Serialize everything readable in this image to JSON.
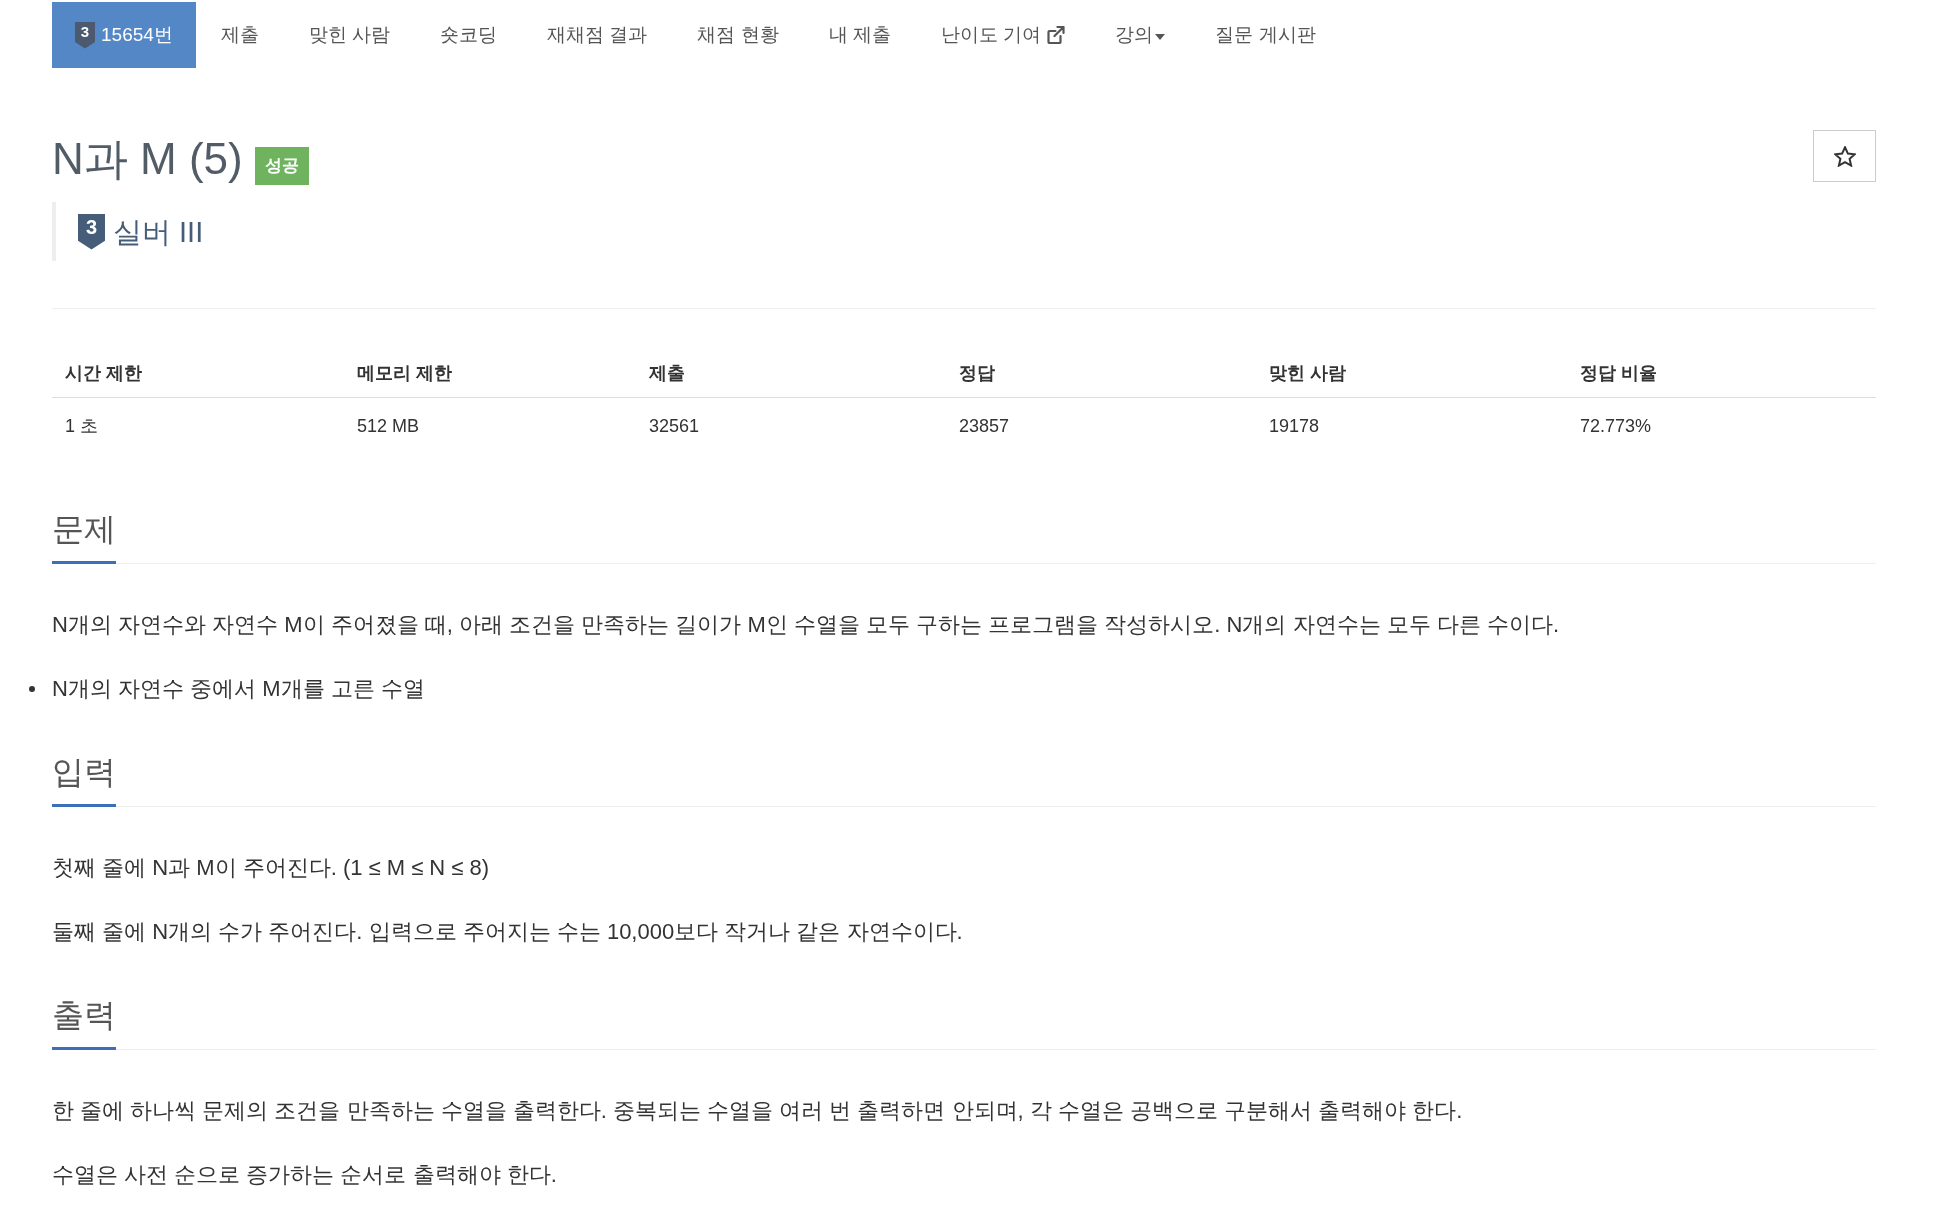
{
  "problem_nav": {
    "items": [
      {
        "kind": "problem",
        "tier_mark": "3",
        "label": "15654번",
        "selected": true
      },
      {
        "kind": "link",
        "label": "제출",
        "selected": false
      },
      {
        "kind": "link",
        "label": "맞힌 사람",
        "selected": false
      },
      {
        "kind": "link",
        "label": "숏코딩",
        "selected": false
      },
      {
        "kind": "link",
        "label": "재채점 결과",
        "selected": false
      },
      {
        "kind": "link",
        "label": "채점 현황",
        "selected": false
      },
      {
        "kind": "link",
        "label": "내 제출",
        "selected": false
      },
      {
        "kind": "external",
        "label": "난이도 기여",
        "selected": false
      },
      {
        "kind": "dropdown",
        "label": "강의",
        "selected": false
      },
      {
        "kind": "link",
        "label": "질문 게시판",
        "selected": false
      }
    ]
  },
  "problem": {
    "title": "N과 M (5)",
    "result_badge": "성공",
    "starred": false,
    "tier_mark": "3",
    "tier": "실버 III"
  },
  "info_table": {
    "columns": [
      "시간 제한",
      "메모리 제한",
      "제출",
      "정답",
      "맞힌 사람",
      "정답 비율"
    ],
    "rows": [
      [
        "1 초",
        "512 MB",
        "32561",
        "23857",
        "19178",
        "72.773%"
      ]
    ]
  },
  "sections": [
    {
      "heading": "문제",
      "blocks": [
        {
          "kind": "paragraph",
          "text": "N개의 자연수와 자연수 M이 주어졌을 때, 아래 조건을 만족하는 길이가 M인 수열을 모두 구하는 프로그램을 작성하시오. N개의 자연수는 모두 다른 수이다."
        },
        {
          "kind": "bullet",
          "text": "N개의 자연수 중에서 M개를 고른 수열"
        }
      ]
    },
    {
      "heading": "입력",
      "blocks": [
        {
          "kind": "paragraph",
          "text": "첫째 줄에 N과 M이 주어진다. (1 ≤ M ≤ N ≤ 8)"
        },
        {
          "kind": "paragraph",
          "text": "둘째 줄에 N개의 수가 주어진다. 입력으로 주어지는 수는 10,000보다 작거나 같은 자연수이다."
        }
      ]
    },
    {
      "heading": "출력",
      "blocks": [
        {
          "kind": "paragraph",
          "text": "한 줄에 하나씩 문제의 조건을 만족하는 수열을 출력한다. 중복되는 수열을 여러 번 출력하면 안되며, 각 수열은 공백으로 구분해서 출력해야 한다."
        },
        {
          "kind": "paragraph",
          "text": "수열은 사전 순으로 증가하는 순서로 출력해야 한다."
        }
      ]
    }
  ]
}
